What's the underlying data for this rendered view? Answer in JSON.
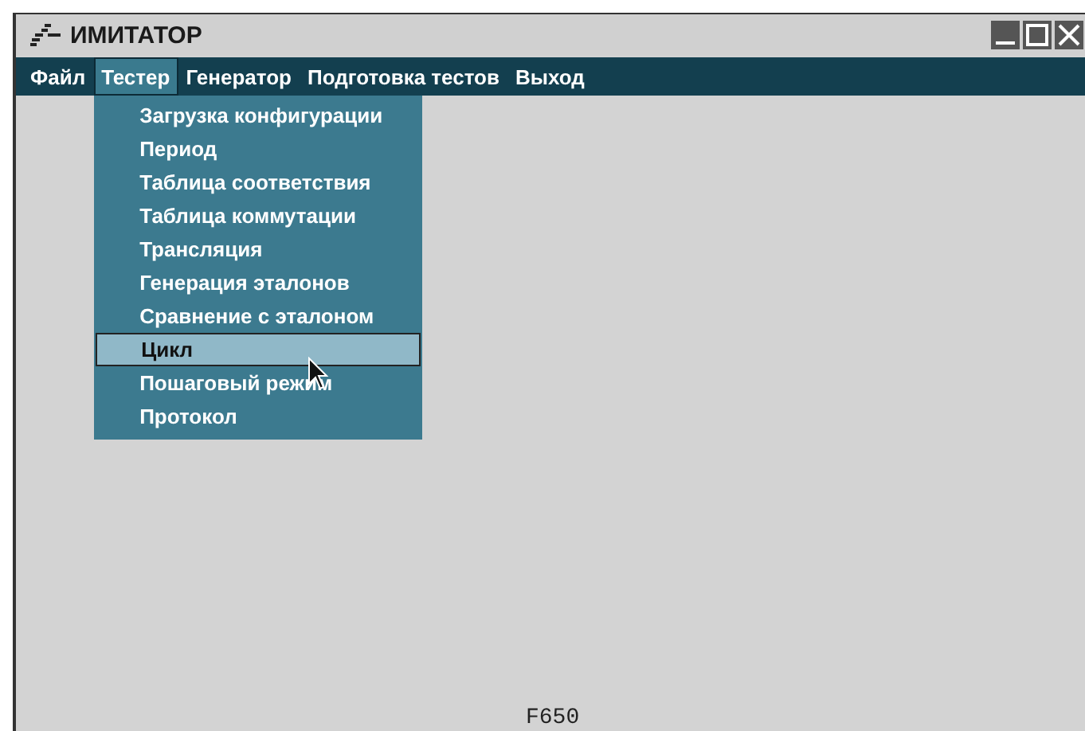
{
  "window": {
    "title": "ИМИТАТОР"
  },
  "menu": [
    {
      "label": "Файл",
      "selected": false
    },
    {
      "label": "Тестер",
      "selected": true
    },
    {
      "label": "Генератор",
      "selected": false
    },
    {
      "label": "Подготовка тестов",
      "selected": false
    },
    {
      "label": "Выход",
      "selected": false
    }
  ],
  "dropdown": [
    {
      "label": "Загрузка конфигурации",
      "selected": false
    },
    {
      "label": "Период",
      "selected": false
    },
    {
      "label": "Таблица соответствия",
      "selected": false
    },
    {
      "label": "Таблица коммутации",
      "selected": false
    },
    {
      "label": "Трансляция",
      "selected": false
    },
    {
      "label": "Генерация эталонов",
      "selected": false
    },
    {
      "label": "Сравнение с эталоном",
      "selected": false
    },
    {
      "label": "Цикл",
      "selected": true
    },
    {
      "label": "Пошаговый режим",
      "selected": false
    },
    {
      "label": "Протокол",
      "selected": false
    }
  ],
  "status": "F650"
}
